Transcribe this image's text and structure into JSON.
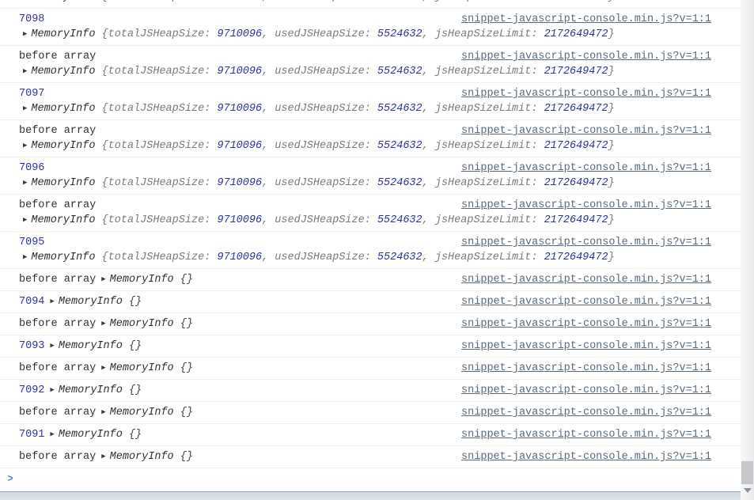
{
  "console": {
    "source_link": "snippet-javascript-console.min.js?v=1:1",
    "prompt_icon": ">",
    "previews": {
      "expand_icon": "▶",
      "class_name": "MemoryInfo",
      "full_tokens": [
        {
          "type": "plain",
          "text": "{totalJSHeapSize: "
        },
        {
          "type": "number",
          "text": "9710096"
        },
        {
          "type": "plain",
          "text": ", usedJSHeapSize: "
        },
        {
          "type": "number",
          "text": "5524632"
        },
        {
          "type": "plain",
          "text": ", jsHeapSizeLimit: "
        },
        {
          "type": "number",
          "text": "2172649472"
        },
        {
          "type": "plain",
          "text": "}"
        }
      ],
      "empty_tokens": [
        {
          "type": "dark",
          "text": "{}"
        }
      ]
    },
    "entries": [
      {
        "kind": "partial",
        "preview": "full"
      },
      {
        "kind": "wrapped",
        "label": "7098",
        "label_type": "number",
        "preview": "full"
      },
      {
        "kind": "wrapped",
        "label": "before array",
        "label_type": "text",
        "preview": "full"
      },
      {
        "kind": "wrapped",
        "label": "7097",
        "label_type": "number",
        "preview": "full"
      },
      {
        "kind": "wrapped",
        "label": "before array",
        "label_type": "text",
        "preview": "full"
      },
      {
        "kind": "wrapped",
        "label": "7096",
        "label_type": "number",
        "preview": "full"
      },
      {
        "kind": "wrapped",
        "label": "before array",
        "label_type": "text",
        "preview": "full"
      },
      {
        "kind": "wrapped",
        "label": "7095",
        "label_type": "number",
        "preview": "full"
      },
      {
        "kind": "single",
        "label": "before array",
        "label_type": "text",
        "preview": "empty"
      },
      {
        "kind": "single",
        "label": "7094",
        "label_type": "number",
        "preview": "empty"
      },
      {
        "kind": "single",
        "label": "before array",
        "label_type": "text",
        "preview": "empty"
      },
      {
        "kind": "single",
        "label": "7093",
        "label_type": "number",
        "preview": "empty"
      },
      {
        "kind": "single",
        "label": "before array",
        "label_type": "text",
        "preview": "empty"
      },
      {
        "kind": "single",
        "label": "7092",
        "label_type": "number",
        "preview": "empty"
      },
      {
        "kind": "single",
        "label": "before array",
        "label_type": "text",
        "preview": "empty"
      },
      {
        "kind": "single",
        "label": "7091",
        "label_type": "number",
        "preview": "empty"
      },
      {
        "kind": "single",
        "label": "before array",
        "label_type": "text",
        "preview": "empty"
      }
    ]
  },
  "colors": {
    "number_blue": "#2e31a3",
    "text_dark": "#303030",
    "object_plain": "#7b7b7b",
    "link": "#5a6b7b",
    "separator": "#efefef",
    "prompt_blue": "#4a7fe8"
  }
}
